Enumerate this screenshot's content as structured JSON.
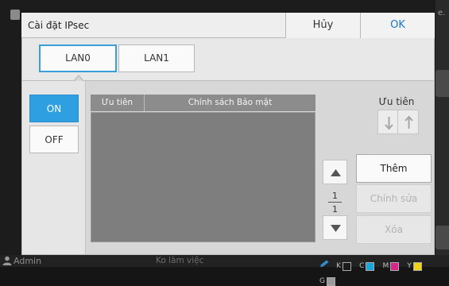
{
  "background": {
    "truncated_text": "e."
  },
  "dialog": {
    "title": "Cài đặt IPsec",
    "cancel_label": "Hủy",
    "ok_label": "OK"
  },
  "tabs": [
    {
      "label": "LAN0",
      "selected": true
    },
    {
      "label": "LAN1",
      "selected": false
    }
  ],
  "toggle": {
    "on_label": "ON",
    "off_label": "OFF",
    "selected": "ON"
  },
  "policy_table": {
    "columns": [
      "Ưu tiên",
      "Chính sách Bảo mật"
    ],
    "rows": []
  },
  "priority": {
    "label": "Ưu tiên"
  },
  "paging": {
    "current": "1",
    "total": "1"
  },
  "actions": {
    "add_label": "Thêm",
    "edit_label": "Chỉnh sửa",
    "delete_label": "Xóa"
  },
  "status_bar": {
    "user": "Admin",
    "status": "Ko làm việc",
    "inks": [
      {
        "label": "K",
        "color": "#1a1a1a"
      },
      {
        "label": "C",
        "color": "#1aa6d8"
      },
      {
        "label": "M",
        "color": "#d4278a"
      },
      {
        "label": "Y",
        "color": "#f0d21a"
      },
      {
        "label": "G",
        "color": "#9a9a9a"
      }
    ]
  },
  "colors": {
    "accent": "#2e9fe0",
    "ok_text": "#1a76c8"
  }
}
